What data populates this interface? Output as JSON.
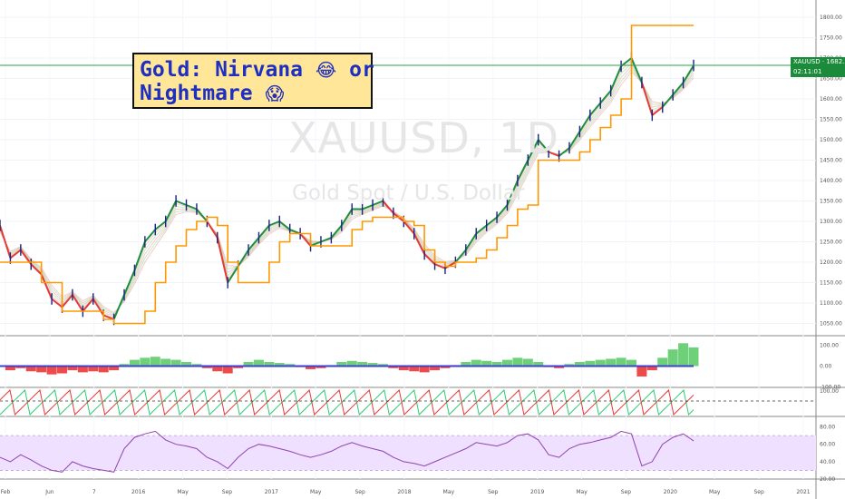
{
  "watermark": {
    "symbol": "XAUUSD, 1D",
    "name": "Gold Spot / U.S. Dollar"
  },
  "title": {
    "line1": "Gold: Nirvana",
    "line1_tail": "or",
    "line2": "Nightmare",
    "emoji1": "😂",
    "emoji2": "😱"
  },
  "price_tag": {
    "symbol": "XAUUSD",
    "price": "1682.20",
    "countdown": "02:11:01"
  },
  "colors": {
    "up": "#1e8f3e",
    "down": "#e53935",
    "candle": "#1a237e",
    "stop_line": "#ff9800",
    "hline": "#27a745",
    "rsi": "#8e44ad",
    "rsi_band": "#efe0ff",
    "bg": "#ffffff"
  },
  "chart_data": [
    {
      "type": "line",
      "panel": "price",
      "y_ticks": [
        "1800.00",
        "1750.00",
        "1700.00",
        "1650.00",
        "1600.00",
        "1550.00",
        "1500.00",
        "1450.00",
        "1400.00",
        "1350.00",
        "1300.00",
        "1250.00",
        "1200.00",
        "1150.00",
        "1100.00",
        "1050.00"
      ],
      "ylim": [
        1020,
        1820
      ],
      "x_labels": [
        "Feb",
        "Jun",
        "7",
        "2016",
        "May",
        "Sep",
        "2017",
        "May",
        "Sep",
        "2018",
        "May",
        "Sep",
        "2019",
        "May",
        "Sep",
        "2020",
        "May",
        "Sep",
        "2021"
      ],
      "series": [
        {
          "values": [
            1290,
            1210,
            1230,
            1195,
            1170,
            1110,
            1090,
            1120,
            1080,
            1110,
            1070,
            1060,
            1120,
            1180,
            1250,
            1280,
            1300,
            1350,
            1340,
            1330,
            1300,
            1260,
            1150,
            1190,
            1230,
            1260,
            1290,
            1300,
            1280,
            1270,
            1240,
            1250,
            1260,
            1290,
            1330,
            1330,
            1340,
            1350,
            1320,
            1300,
            1270,
            1220,
            1195,
            1185,
            1200,
            1230,
            1270,
            1290,
            1310,
            1340,
            1400,
            1450,
            1500,
            1470,
            1460,
            1480,
            1520,
            1560,
            1590,
            1620,
            1680,
            1700,
            1640,
            1560,
            1580,
            1610,
            1640,
            1682
          ]
        },
        {
          "values": [
            1270,
            1230,
            1240,
            1210,
            1190,
            1150,
            1120,
            1130,
            1110,
            1120,
            1095,
            1080,
            1100,
            1140,
            1190,
            1230,
            1270,
            1310,
            1320,
            1320,
            1300,
            1270,
            1200,
            1190,
            1210,
            1240,
            1265,
            1280,
            1275,
            1270,
            1255,
            1250,
            1255,
            1270,
            1300,
            1315,
            1325,
            1335,
            1325,
            1310,
            1285,
            1250,
            1220,
            1205,
            1205,
            1215,
            1245,
            1270,
            1290,
            1315,
            1360,
            1410,
            1460,
            1470,
            1465,
            1470,
            1495,
            1525,
            1555,
            1585,
            1625,
            1660,
            1640,
            1600,
            1590,
            1600,
            1620,
            1645
          ]
        },
        {
          "values": [
            1200,
            1200,
            1200,
            1200,
            1150,
            1150,
            1080,
            1080,
            1080,
            1080,
            1060,
            1050,
            1050,
            1050,
            1080,
            1150,
            1200,
            1240,
            1280,
            1300,
            1310,
            1290,
            1200,
            1150,
            1150,
            1150,
            1200,
            1250,
            1270,
            1270,
            1240,
            1240,
            1240,
            1240,
            1280,
            1300,
            1310,
            1310,
            1310,
            1300,
            1290,
            1230,
            1200,
            1190,
            1200,
            1200,
            1210,
            1230,
            1260,
            1290,
            1330,
            1340,
            1450,
            1450,
            1450,
            1450,
            1470,
            1500,
            1530,
            1560,
            1600,
            1780,
            1780,
            1780,
            1780,
            1780,
            1780,
            1780
          ]
        },
        {
          "values": [
            0.0,
            -20.0,
            -10.0,
            -25.0,
            -30.0,
            -40.0,
            -35.0,
            -20.0,
            -30.0,
            -25.0,
            -30.0,
            -20.0,
            10.0,
            30.0,
            40.0,
            45.0,
            35.0,
            30.0,
            20.0,
            10.0,
            -10.0,
            -25.0,
            -35.0,
            -10.0,
            20.0,
            30.0,
            20.0,
            15.0,
            10.0,
            -5.0,
            -15.0,
            -10.0,
            5.0,
            20.0,
            25.0,
            20.0,
            15.0,
            10.0,
            -10.0,
            -20.0,
            -25.0,
            -30.0,
            -20.0,
            -10.0,
            5.0,
            20.0,
            30.0,
            25.0,
            20.0,
            30.0,
            40.0,
            35.0,
            20.0,
            -5.0,
            -10.0,
            10.0,
            20.0,
            25.0,
            30.0,
            35.0,
            40.0,
            30.0,
            -50.0,
            -20.0,
            40.0,
            80.0,
            110.0,
            90.0
          ]
        },
        {
          "values": [
            45,
            40,
            48,
            42,
            35,
            30,
            28,
            40,
            35,
            32,
            30,
            28,
            55,
            68,
            72,
            75,
            65,
            60,
            58,
            55,
            45,
            40,
            32,
            45,
            55,
            60,
            58,
            55,
            52,
            48,
            45,
            48,
            52,
            58,
            62,
            58,
            55,
            52,
            45,
            40,
            38,
            35,
            40,
            45,
            50,
            55,
            62,
            60,
            58,
            62,
            70,
            72,
            65,
            48,
            45,
            55,
            60,
            62,
            65,
            68,
            75,
            72,
            35,
            40,
            60,
            68,
            72,
            64
          ]
        }
      ],
      "ylim_rsi": [
        20,
        90
      ],
      "rsi_ticks": [
        "80.00",
        "60.00",
        "40.00",
        "20.00"
      ],
      "osc_ticks": [
        "100.00",
        "0.00",
        "-100.00"
      ],
      "stoch_ticks": [
        "100.00"
      ],
      "current_price": "1682.20"
    }
  ]
}
